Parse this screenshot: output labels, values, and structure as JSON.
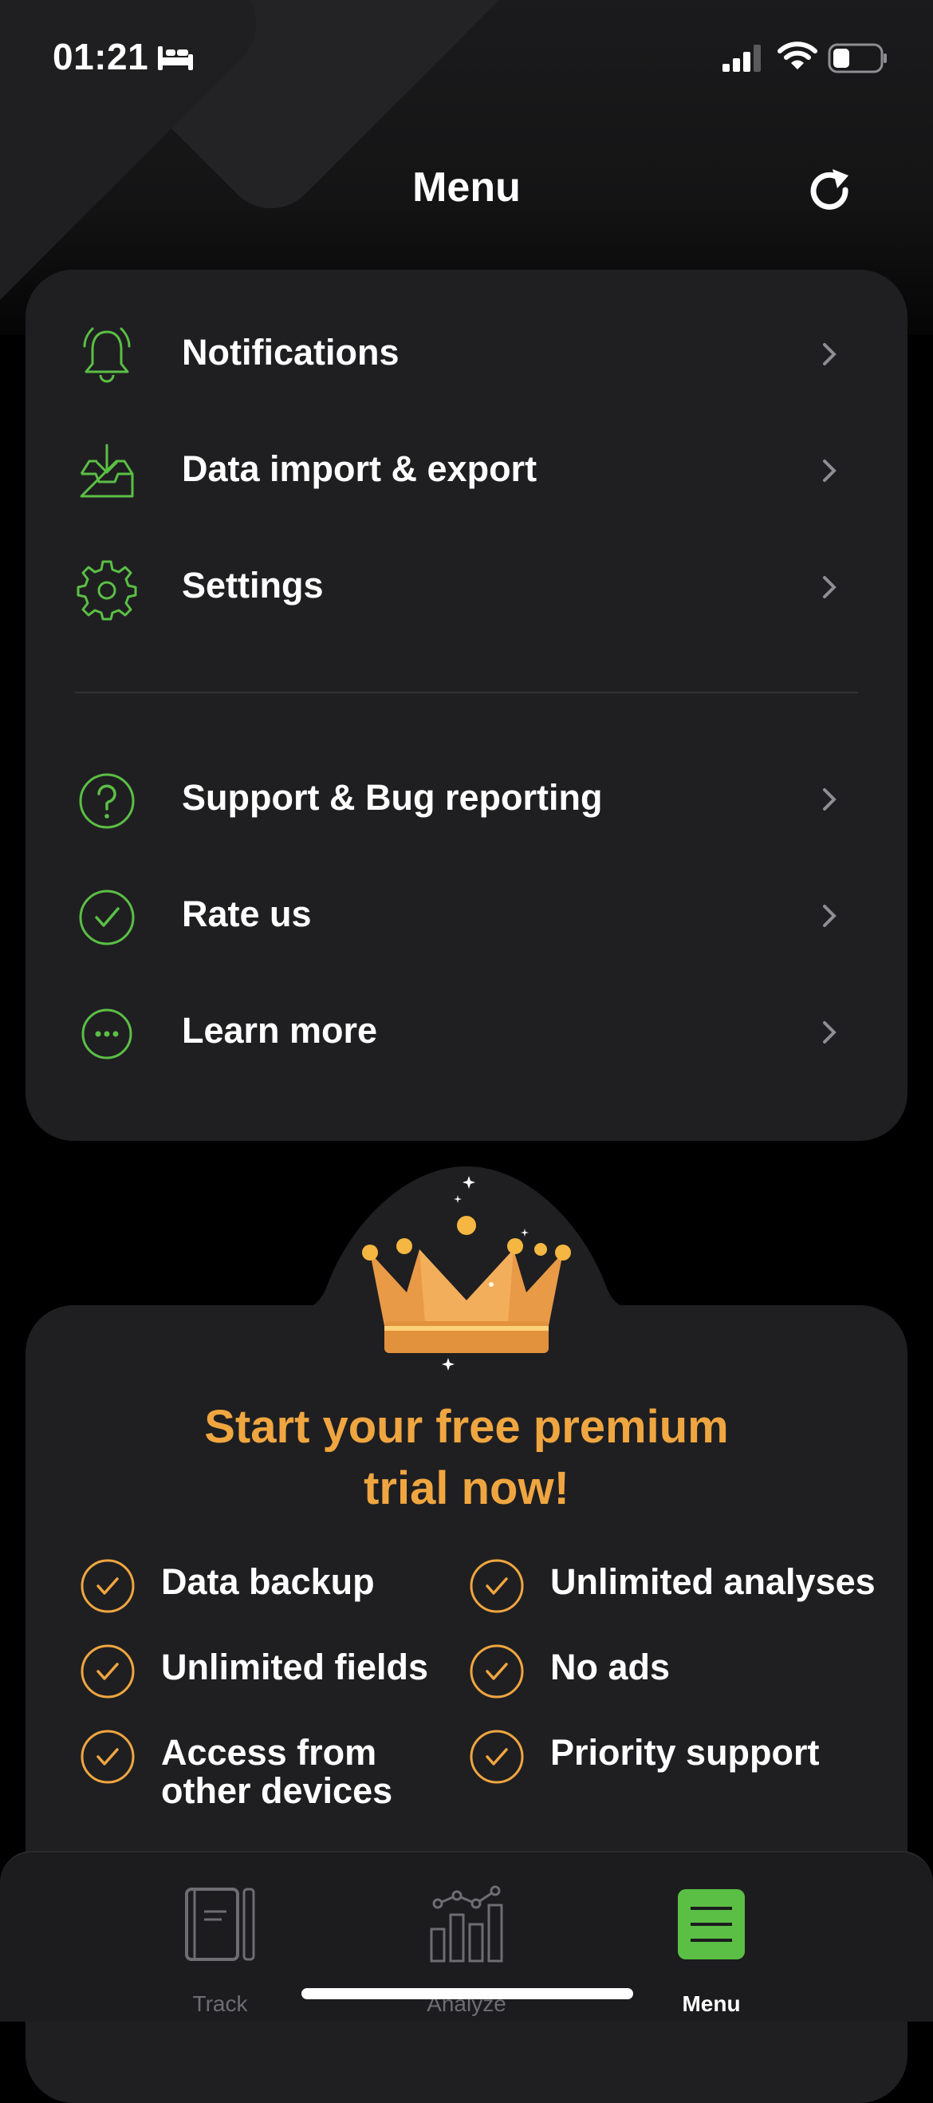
{
  "colors": {
    "accent_green": "#5bbf45",
    "premium_orange": "#f0a640",
    "card_bg": "#1f1f21"
  },
  "status_bar": {
    "time": "01:21",
    "icons": [
      "bed-icon",
      "signal-icon",
      "wifi-icon",
      "battery-icon"
    ]
  },
  "header": {
    "title": "Menu",
    "right_icon": "refresh-icon"
  },
  "menu": {
    "group1": [
      {
        "label": "Notifications",
        "icon": "bell-icon"
      },
      {
        "label": "Data import & export",
        "icon": "inbox-download-icon"
      },
      {
        "label": "Settings",
        "icon": "gear-icon"
      }
    ],
    "group2": [
      {
        "label": "Support & Bug reporting",
        "icon": "question-circle-icon"
      },
      {
        "label": "Rate us",
        "icon": "check-circle-icon"
      },
      {
        "label": "Learn more",
        "icon": "more-circle-icon"
      }
    ]
  },
  "premium": {
    "title_line1": "Start your free premium",
    "title_line2": "trial now!",
    "features": [
      "Data backup",
      "Unlimited analyses",
      "Unlimited fields",
      "No ads",
      "Access from",
      "other devices",
      "Priority support"
    ]
  },
  "tabbar": {
    "tabs": [
      {
        "label": "Track",
        "icon": "notebook-icon",
        "active": false
      },
      {
        "label": "Analyze",
        "icon": "chart-icon",
        "active": false
      },
      {
        "label": "Menu",
        "icon": "menu-icon",
        "active": true
      }
    ]
  }
}
